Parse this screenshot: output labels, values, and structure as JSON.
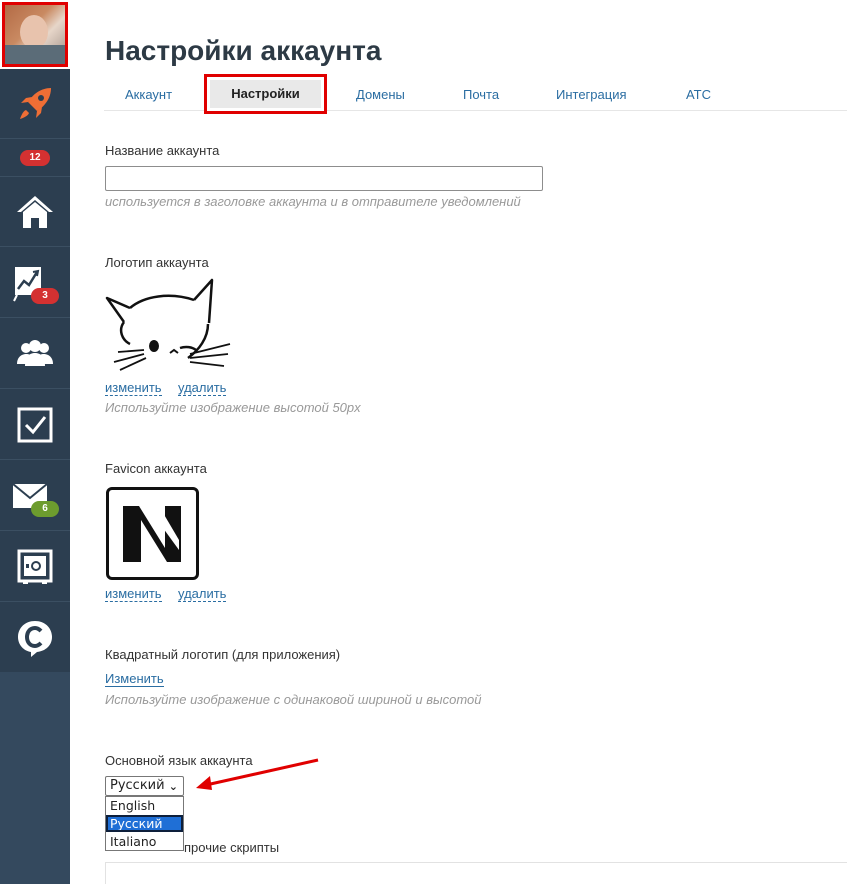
{
  "sidebar": {
    "badges": {
      "calls": "12",
      "stats": "3",
      "mail": "6"
    },
    "items": [
      {
        "icon": "rocket-icon",
        "color": "#ef6e35"
      },
      {
        "icon": "home-icon"
      },
      {
        "icon": "chart-icon"
      },
      {
        "icon": "contacts-icon"
      },
      {
        "icon": "tasks-icon"
      },
      {
        "icon": "mail-icon"
      },
      {
        "icon": "settings-safe-icon"
      },
      {
        "icon": "chat-icon"
      }
    ]
  },
  "page": {
    "title": "Настройки аккаунта"
  },
  "tabs": [
    "Аккаунт",
    "Настройки",
    "Домены",
    "Почта",
    "Интеграция",
    "АТС"
  ],
  "active_tab": "Настройки",
  "account_name": {
    "label": "Название аккаунта",
    "value": "",
    "hint": "используется в заголовке аккаунта и в отправителе уведомлений"
  },
  "account_logo": {
    "label": "Логотип аккаунта",
    "change": "изменить",
    "delete": "удалить",
    "hint": "Используйте изображение высотой 50px"
  },
  "favicon": {
    "label": "Favicon аккаунта",
    "change": "изменить",
    "delete": "удалить"
  },
  "square_logo": {
    "label": "Квадратный логотип (для приложения)",
    "change": "Изменить",
    "hint": "Используйте изображение с одинаковой шириной и высотой"
  },
  "language": {
    "label": "Основной язык аккаунта",
    "selected": "Русский",
    "options": [
      "English",
      "Русский",
      "Italiano"
    ]
  },
  "scripts": {
    "label_visible": "прочие скрипты"
  },
  "colors": {
    "accent": "#2a6da2",
    "highlight": "#e00000",
    "sidebar": "#2c3e50"
  }
}
